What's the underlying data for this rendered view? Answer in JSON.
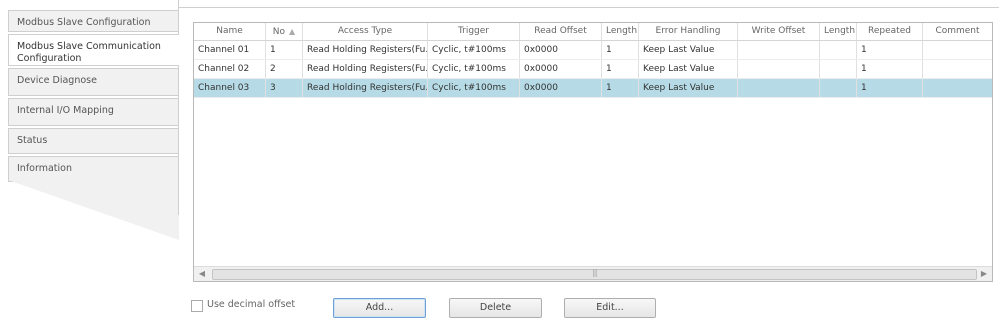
{
  "tabs": [
    {
      "label": "Modbus Slave Configuration",
      "active": false
    },
    {
      "label": "Modbus Slave Communication Configuration",
      "active": true
    },
    {
      "label": "Device Diagnose",
      "active": false
    },
    {
      "label": "Internal I/O Mapping",
      "active": false
    },
    {
      "label": "Status",
      "active": false
    },
    {
      "label": "Information",
      "active": false
    }
  ],
  "table": {
    "columns": [
      "Name",
      "No",
      "Access Type",
      "Trigger",
      "Read Offset",
      "Length",
      "Error Handling",
      "Write Offset",
      "Length",
      "Repeated",
      "Comment"
    ],
    "rows": [
      {
        "name": "Channel 01",
        "no": "1",
        "access": "Read Holding Registers(Fu...",
        "trigger": "Cyclic, t#100ms",
        "read_offset": "0x0000",
        "length": "1",
        "error": "Keep Last Value",
        "write_offset": "",
        "length2": "",
        "repeated": "1",
        "comment": "",
        "selected": false
      },
      {
        "name": "Channel 02",
        "no": "2",
        "access": "Read Holding Registers(Fu...",
        "trigger": "Cyclic, t#100ms",
        "read_offset": "0x0000",
        "length": "1",
        "error": "Keep Last Value",
        "write_offset": "",
        "length2": "",
        "repeated": "1",
        "comment": "",
        "selected": false
      },
      {
        "name": "Channel 03",
        "no": "3",
        "access": "Read Holding Registers(Fu...",
        "trigger": "Cyclic, t#100ms",
        "read_offset": "0x0000",
        "length": "1",
        "error": "Keep Last Value",
        "write_offset": "",
        "length2": "",
        "repeated": "1",
        "comment": "",
        "selected": true
      }
    ],
    "sort_indicator": "▲"
  },
  "controls": {
    "use_decimal_offset_label": "Use decimal offset",
    "use_decimal_offset_checked": false,
    "add_label": "Add...",
    "delete_label": "Delete",
    "edit_label": "Edit..."
  },
  "colors": {
    "selected_row": "#b6dbe6",
    "focus_border": "#6f9fd3"
  }
}
